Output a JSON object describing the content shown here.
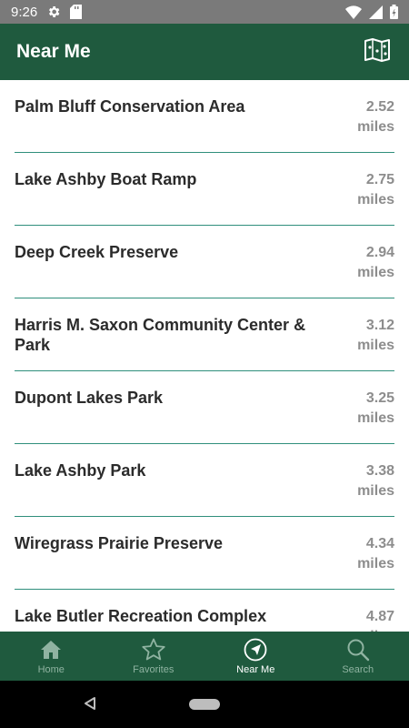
{
  "status": {
    "time": "9:26",
    "icons": [
      "gear-icon",
      "sd-card-icon",
      "wifi-icon",
      "signal-icon",
      "battery-icon"
    ]
  },
  "app_bar": {
    "title": "Near Me",
    "action_icon": "map-icon"
  },
  "places": [
    {
      "name": "Palm Bluff Conservation Area",
      "distance": "2.52",
      "unit": "miles"
    },
    {
      "name": "Lake Ashby Boat Ramp",
      "distance": "2.75",
      "unit": "miles"
    },
    {
      "name": "Deep Creek Preserve",
      "distance": "2.94",
      "unit": "miles"
    },
    {
      "name": "Harris M. Saxon Community Center & Park",
      "distance": "3.12",
      "unit": "miles"
    },
    {
      "name": "Dupont Lakes Park",
      "distance": "3.25",
      "unit": "miles"
    },
    {
      "name": "Lake Ashby Park",
      "distance": "3.38",
      "unit": "miles"
    },
    {
      "name": "Wiregrass Prairie Preserve",
      "distance": "4.34",
      "unit": "miles"
    },
    {
      "name": "Lake Butler Recreation Complex",
      "distance": "4.87",
      "unit": "miles"
    }
  ],
  "bottom_nav": {
    "tabs": [
      {
        "label": "Home",
        "icon": "home-icon"
      },
      {
        "label": "Favorites",
        "icon": "star-icon"
      },
      {
        "label": "Near Me",
        "icon": "navigation-icon"
      },
      {
        "label": "Search",
        "icon": "search-icon"
      }
    ],
    "active": "Near Me"
  },
  "colors": {
    "primary": "#1f5a3e",
    "divider": "#2f8f7c",
    "text": "#2b2b2b",
    "muted": "#8d8d8d"
  }
}
